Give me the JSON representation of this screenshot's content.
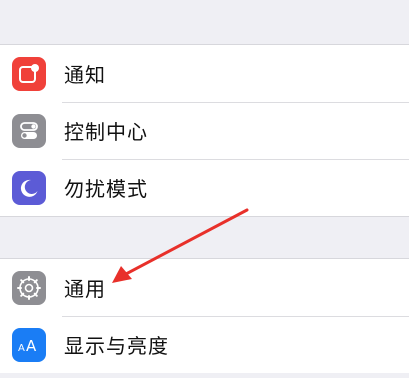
{
  "settings_group_1": {
    "items": [
      {
        "label": "通知",
        "icon": "notifications-icon",
        "color": "#f0413a"
      },
      {
        "label": "控制中心",
        "icon": "control-center-icon",
        "color": "#8e8e93"
      },
      {
        "label": "勿扰模式",
        "icon": "do-not-disturb-icon",
        "color": "#5c5bd6"
      }
    ]
  },
  "settings_group_2": {
    "items": [
      {
        "label": "通用",
        "icon": "gear-icon",
        "color": "#8e8e93"
      },
      {
        "label": "显示与亮度",
        "icon": "display-brightness-icon",
        "color": "#1a7df5"
      }
    ]
  },
  "annotation": {
    "arrow_color": "#e8302a"
  }
}
